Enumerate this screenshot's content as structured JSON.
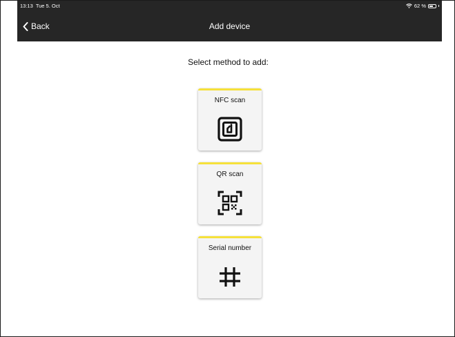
{
  "status": {
    "time": "13:13",
    "date": "Tue 5. Oct",
    "battery_text": "62 %",
    "battery_level": 0.62
  },
  "nav": {
    "back_label": "Back",
    "title": "Add device"
  },
  "prompt": "Select method to add:",
  "methods": [
    {
      "label": "NFC scan",
      "icon": "nfc-icon"
    },
    {
      "label": "QR scan",
      "icon": "qr-code-icon"
    },
    {
      "label": "Serial number",
      "icon": "hash-icon"
    }
  ],
  "colors": {
    "bar_background": "#262626",
    "card_accent": "#f6e13a",
    "card_background": "#f4f4f4"
  }
}
